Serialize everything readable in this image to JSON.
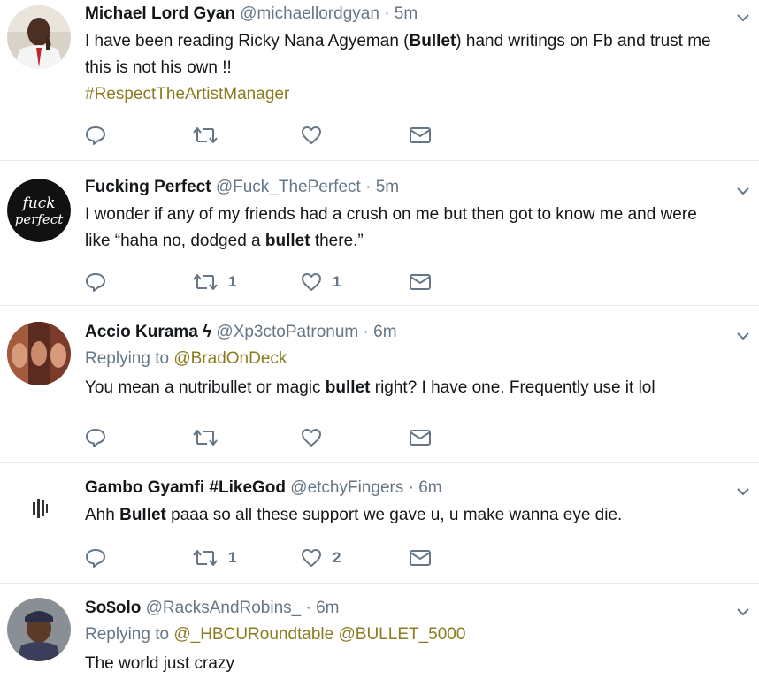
{
  "tweets": [
    {
      "name": "Michael Lord Gyan",
      "handle": "@michaellordgyan",
      "sep": "·",
      "time": "5m",
      "text_parts": [
        "I have been reading Ricky Nana Agyeman (",
        "Bullet",
        ") hand writings on Fb and trust me this is not his own !!"
      ],
      "hashtag": "#RespectTheArtistManager",
      "retweets": "",
      "likes": ""
    },
    {
      "name": "Fucking Perfect",
      "handle": "@Fuck_ThePerfect",
      "sep": "·",
      "time": "5m",
      "avatar_text": "fuck perfect",
      "text_parts": [
        "I wonder if any of my friends had a crush on me but then got to know me and were like “haha no, dodged a ",
        "bullet",
        " there.”"
      ],
      "retweets": "1",
      "likes": "1"
    },
    {
      "name": "Accio Kurama",
      "name_symbol": "ϟ",
      "handle": "@Xp3ctoPatronum",
      "sep": "·",
      "time": "6m",
      "replying_prefix": "Replying to",
      "replying_to": "@BradOnDeck",
      "text_parts": [
        "You mean a nutribullet or magic ",
        "bullet",
        " right? I have one. Frequently use it lol"
      ],
      "retweets": "",
      "likes": ""
    },
    {
      "name": "Gambo Gyamfi #LikeGod",
      "handle": "@etchyFingers",
      "sep": "·",
      "time": "6m",
      "text_parts": [
        "Ahh ",
        "Bullet",
        " paaa so all these support we gave u, u make wanna eye die."
      ],
      "retweets": "1",
      "likes": "2"
    },
    {
      "name": "So$olo",
      "handle": "@RacksAndRobins_",
      "sep": "·",
      "time": "6m",
      "replying_prefix": "Replying to",
      "replying_to": "@_HBCURoundtable @BULLET_5000",
      "text": "The world just crazy"
    }
  ],
  "colors": {
    "link_olive": "#8b7b1f",
    "muted": "#657786",
    "divider": "#e6ecf0"
  },
  "icons": [
    "reply-icon",
    "retweet-icon",
    "like-icon",
    "message-icon",
    "chevron-down-icon"
  ]
}
